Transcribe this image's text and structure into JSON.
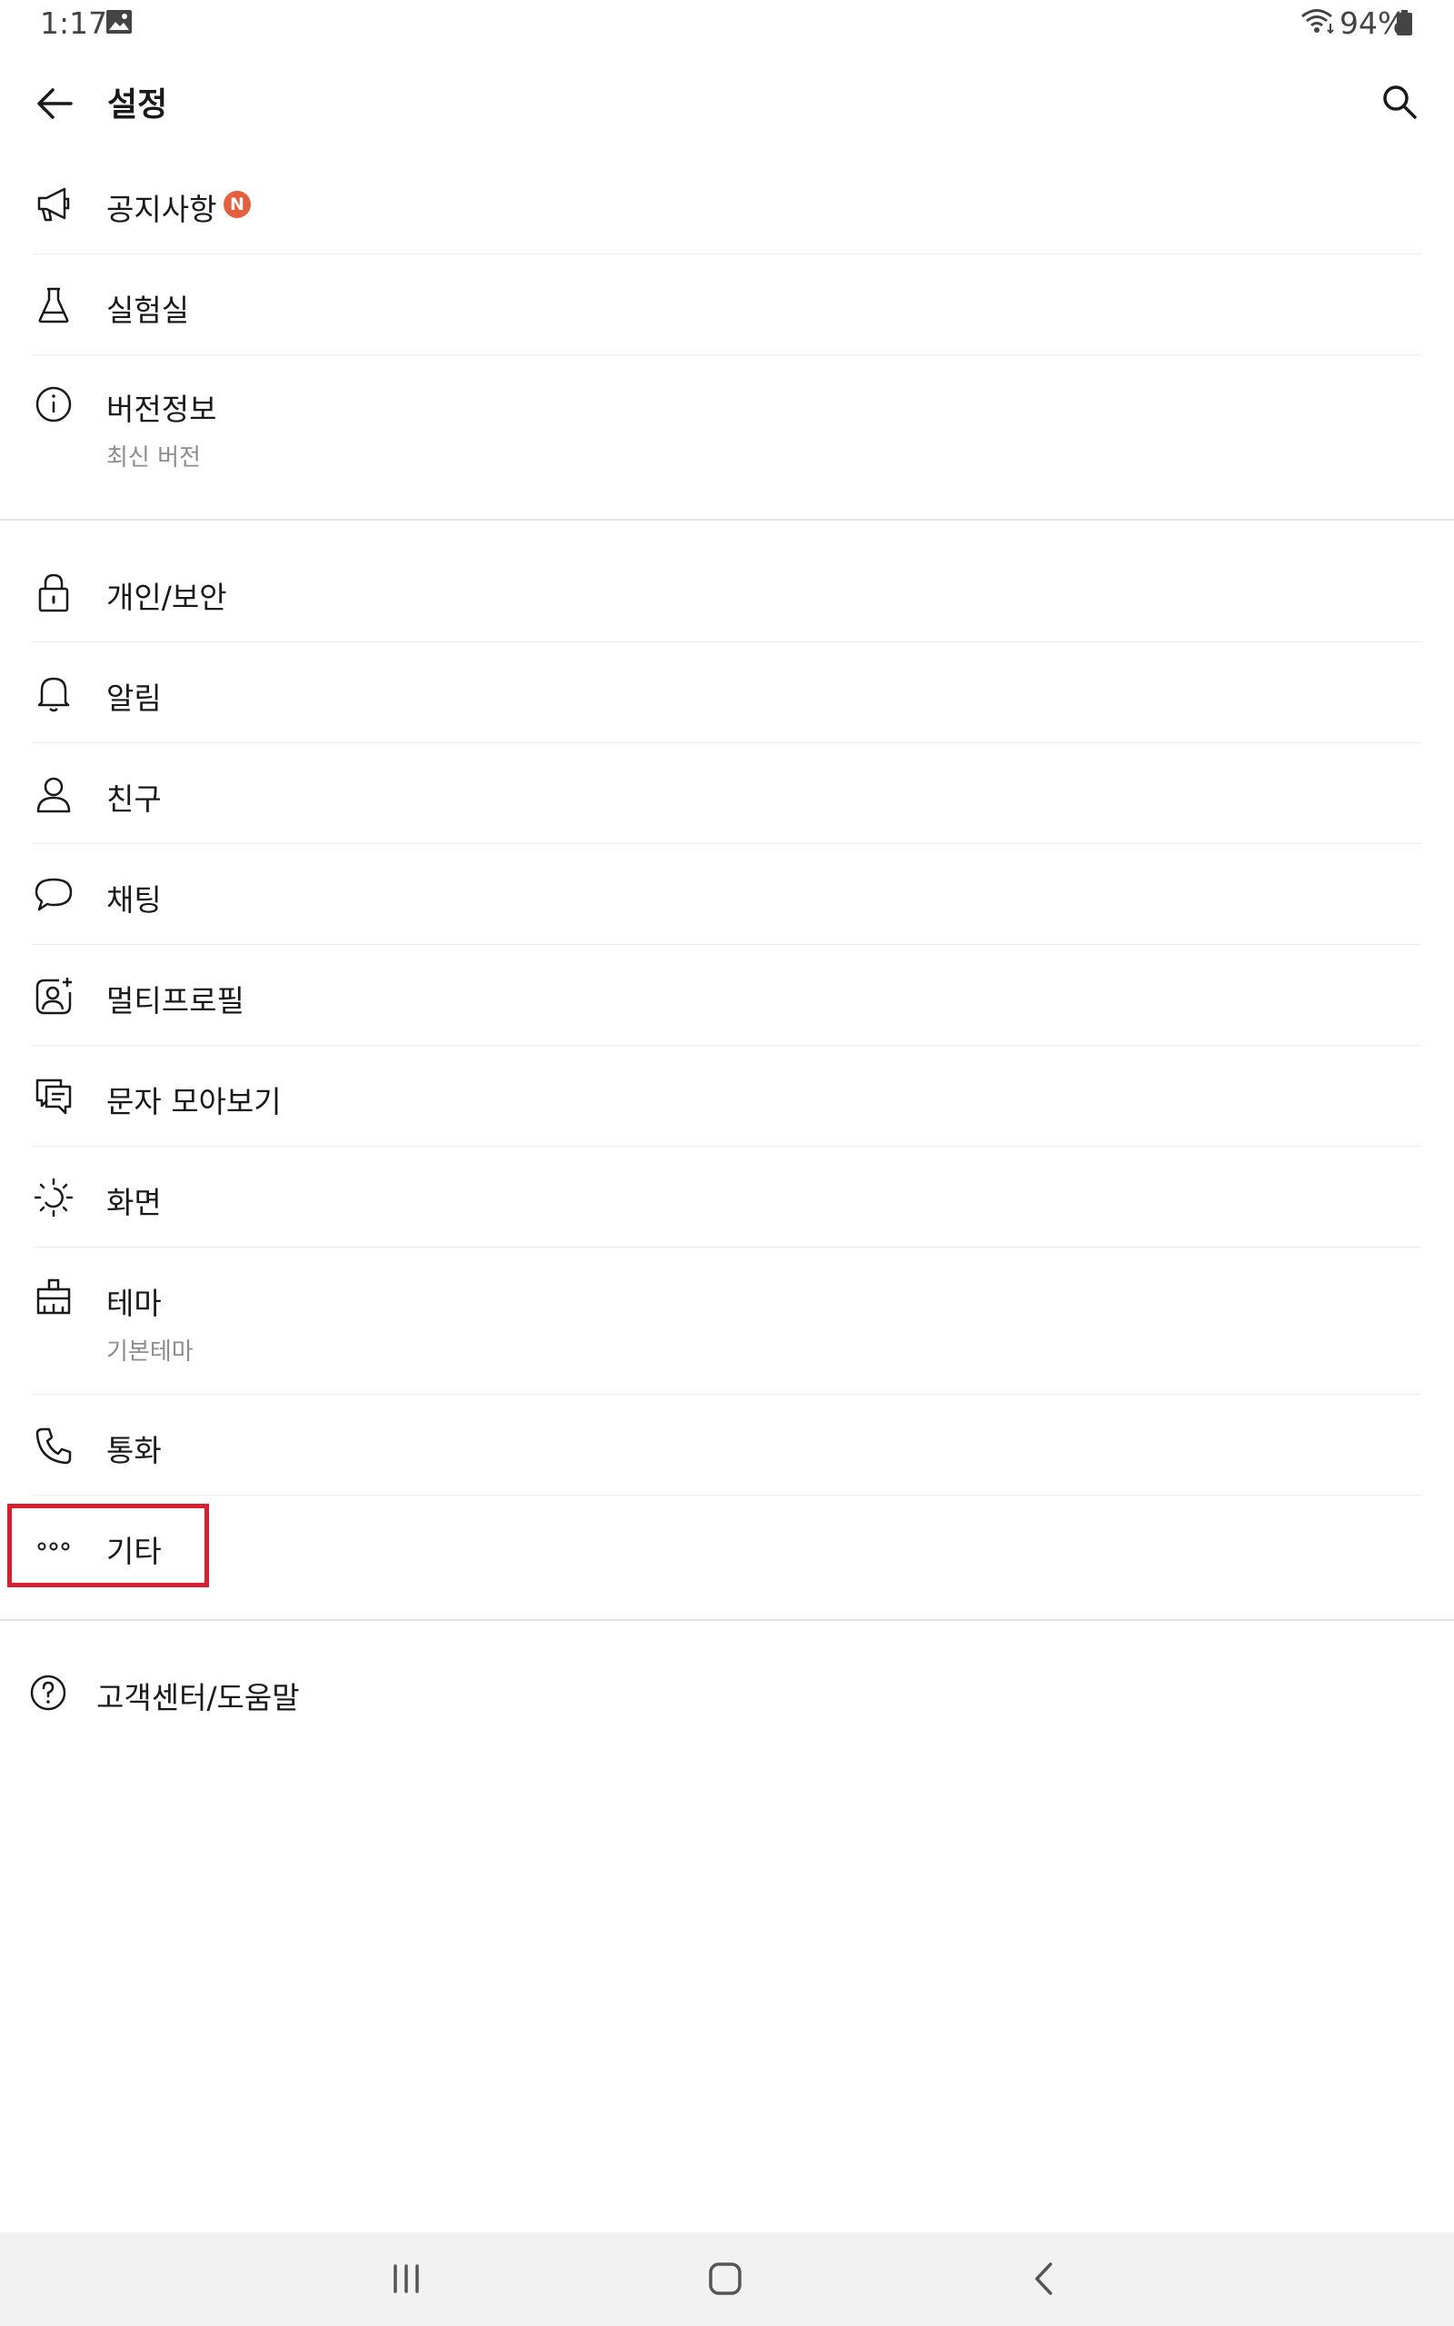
{
  "status_bar": {
    "time": "1:17",
    "battery": "94%"
  },
  "header": {
    "title": "설정"
  },
  "section1": [
    {
      "label": "공지사항",
      "badge": "N",
      "icon": "megaphone-icon"
    },
    {
      "label": "실험실",
      "icon": "flask-icon"
    },
    {
      "label": "버전정보",
      "sub": "최신 버전",
      "icon": "info-icon"
    }
  ],
  "section2": [
    {
      "label": "개인/보안",
      "icon": "lock-icon"
    },
    {
      "label": "알림",
      "icon": "bell-icon"
    },
    {
      "label": "친구",
      "icon": "person-icon"
    },
    {
      "label": "채팅",
      "icon": "chat-bubble-icon"
    },
    {
      "label": "멀티프로필",
      "icon": "multi-profile-icon"
    },
    {
      "label": "문자 모아보기",
      "icon": "message-collect-icon"
    },
    {
      "label": "화면",
      "icon": "brightness-icon"
    },
    {
      "label": "테마",
      "sub": "기본테마",
      "icon": "paint-brush-icon"
    },
    {
      "label": "통화",
      "icon": "phone-icon"
    },
    {
      "label": "기타",
      "icon": "more-dots-icon"
    }
  ],
  "section3": [
    {
      "label": "고객센터/도움말",
      "icon": "help-circle-icon"
    }
  ],
  "colors": {
    "badge": "#e3603f",
    "highlight_box": "#d6202f",
    "nav_bar": "#f2f2f2"
  }
}
